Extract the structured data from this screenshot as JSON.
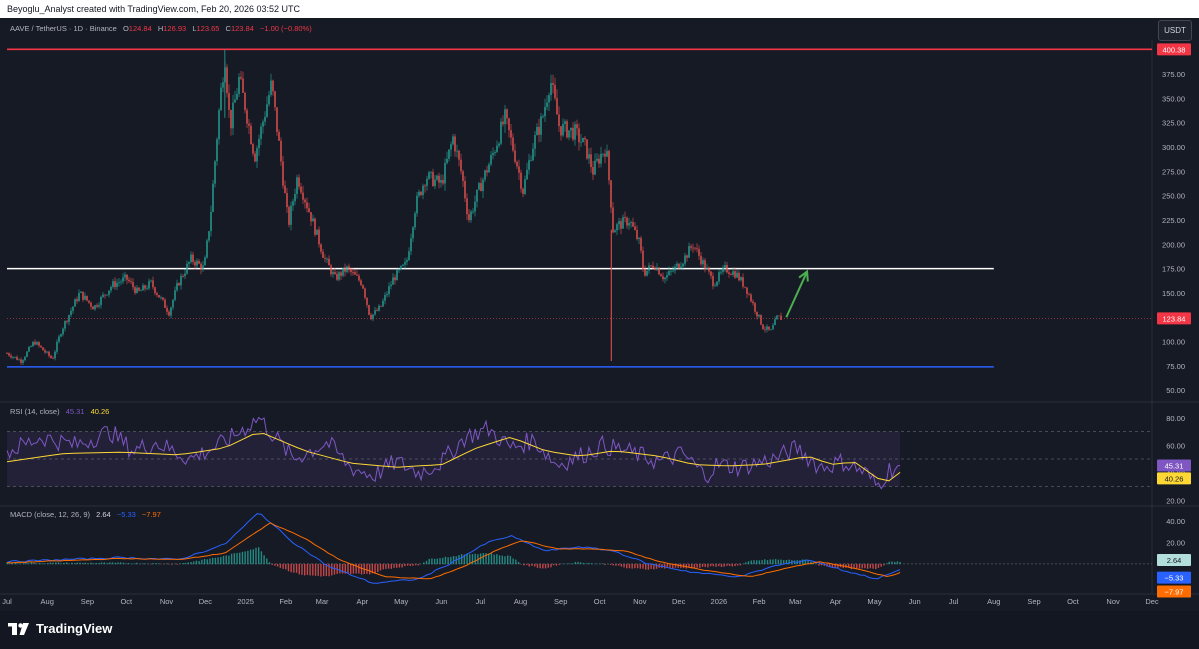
{
  "header": {
    "credit": "Beyoglu_Analyst created with TradingView.com, Feb 20, 2026 03:52 UTC"
  },
  "legend": {
    "symbol": "AAVE / TetherUS · 1D · Binance",
    "o_label": "O",
    "o_value": "124.84",
    "h_label": "H",
    "h_value": "126.93",
    "l_label": "L",
    "l_value": "123.65",
    "c_label": "C",
    "c_value": "123.84",
    "change": "−1.00 (−0.80%)"
  },
  "currency_button": "USDT",
  "rsi_legend": {
    "title": "RSI (14, close)",
    "rsi": "45.31",
    "ma": "40.26"
  },
  "macd_legend": {
    "title": "MACD (close, 12, 26, 9)",
    "hist": "2.64",
    "macd": "−5.33",
    "signal": "−7.97"
  },
  "footer": {
    "brand": "TradingView"
  },
  "colors": {
    "up": "#26a69a",
    "down": "#ef5350",
    "resistance": "#f23645",
    "support": "#2962ff",
    "level": "#ffffff",
    "arrow": "#4caf50",
    "rsi": "#7e57c2",
    "rsi_ma": "#fdd835",
    "macd": "#2962ff",
    "signal": "#ff6d00"
  },
  "chart_data": [
    {
      "type": "candlestick",
      "title": "AAVE / TetherUS · 1D · Binance",
      "x_ticks": [
        "Jul",
        "Aug",
        "Sep",
        "Oct",
        "Nov",
        "Dec",
        "2025",
        "Feb",
        "Mar",
        "Apr",
        "May",
        "Jun",
        "Jul",
        "Aug",
        "Sep",
        "Oct",
        "Nov",
        "Dec",
        "2026",
        "Feb",
        "Mar",
        "Apr",
        "May",
        "Jun",
        "Jul",
        "Aug",
        "Sep",
        "Oct",
        "Nov",
        "Dec"
      ],
      "y_ticks": [
        50,
        75,
        100,
        125,
        150,
        175,
        200,
        225,
        250,
        275,
        300,
        325,
        350,
        375
      ],
      "ylim": [
        42,
        410
      ],
      "price_path": [
        [
          "2024-07-01",
          88
        ],
        [
          "2024-07-12",
          80
        ],
        [
          "2024-07-22",
          100
        ],
        [
          "2024-08-05",
          82
        ],
        [
          "2024-08-12",
          112
        ],
        [
          "2024-08-26",
          150
        ],
        [
          "2024-09-06",
          135
        ],
        [
          "2024-09-20",
          158
        ],
        [
          "2024-10-01",
          165
        ],
        [
          "2024-10-10",
          150
        ],
        [
          "2024-10-20",
          160
        ],
        [
          "2024-11-03",
          130
        ],
        [
          "2024-11-10",
          160
        ],
        [
          "2024-11-20",
          185
        ],
        [
          "2024-11-30",
          175
        ],
        [
          "2024-12-05",
          230
        ],
        [
          "2024-12-12",
          345
        ],
        [
          "2024-12-16",
          395
        ],
        [
          "2024-12-20",
          320
        ],
        [
          "2024-12-27",
          370
        ],
        [
          "2025-01-01",
          340
        ],
        [
          "2025-01-08",
          290
        ],
        [
          "2025-01-15",
          330
        ],
        [
          "2025-01-21",
          365
        ],
        [
          "2025-01-27",
          300
        ],
        [
          "2025-02-03",
          220
        ],
        [
          "2025-02-10",
          270
        ],
        [
          "2025-02-20",
          230
        ],
        [
          "2025-03-03",
          185
        ],
        [
          "2025-03-11",
          165
        ],
        [
          "2025-03-20",
          175
        ],
        [
          "2025-04-01",
          160
        ],
        [
          "2025-04-07",
          125
        ],
        [
          "2025-04-15",
          135
        ],
        [
          "2025-04-25",
          165
        ],
        [
          "2025-05-05",
          180
        ],
        [
          "2025-05-12",
          240
        ],
        [
          "2025-05-20",
          270
        ],
        [
          "2025-06-01",
          262
        ],
        [
          "2025-06-10",
          310
        ],
        [
          "2025-06-17",
          270
        ],
        [
          "2025-06-22",
          225
        ],
        [
          "2025-07-01",
          260
        ],
        [
          "2025-07-10",
          290
        ],
        [
          "2025-07-20",
          330
        ],
        [
          "2025-07-28",
          290
        ],
        [
          "2025-08-03",
          255
        ],
        [
          "2025-08-10",
          300
        ],
        [
          "2025-08-18",
          330
        ],
        [
          "2025-08-24",
          370
        ],
        [
          "2025-08-31",
          320
        ],
        [
          "2025-09-12",
          315
        ],
        [
          "2025-09-20",
          300
        ],
        [
          "2025-09-26",
          275
        ],
        [
          "2025-10-01",
          290
        ],
        [
          "2025-10-06",
          300
        ],
        [
          "2025-10-10",
          240
        ],
        [
          "2025-10-11",
          215
        ],
        [
          "2025-10-16",
          220
        ],
        [
          "2025-10-24",
          225
        ],
        [
          "2025-11-01",
          200
        ],
        [
          "2025-11-04",
          170
        ],
        [
          "2025-11-12",
          180
        ],
        [
          "2025-11-20",
          165
        ],
        [
          "2025-11-28",
          175
        ],
        [
          "2025-12-05",
          185
        ],
        [
          "2025-12-12",
          200
        ],
        [
          "2025-12-20",
          180
        ],
        [
          "2025-12-28",
          160
        ],
        [
          "2026-01-06",
          175
        ],
        [
          "2026-01-14",
          170
        ],
        [
          "2026-01-22",
          155
        ],
        [
          "2026-01-30",
          130
        ],
        [
          "2026-02-04",
          115
        ],
        [
          "2026-02-10",
          110
        ],
        [
          "2026-02-15",
          125
        ],
        [
          "2026-02-19",
          123.84
        ]
      ],
      "extremes": {
        "low_wick": {
          "date": "2025-10-10",
          "value": 80
        },
        "peak": {
          "date": "2024-12-16",
          "value": 400
        }
      },
      "horizontal_lines": [
        {
          "value": 400.38,
          "label": "400.38",
          "color": "#f23645",
          "end": "right-edge"
        },
        {
          "value": 175,
          "label": "",
          "color": "#ffffff",
          "end": "2026-08-01"
        },
        {
          "value": 74,
          "label": "",
          "color": "#2962ff",
          "end": "2026-08-01"
        }
      ],
      "last_price": {
        "value": 123.84,
        "label": "123.84"
      },
      "arrow": {
        "from": [
          "2026-02-22",
          125
        ],
        "to": [
          "2026-03-10",
          172
        ],
        "color": "#4caf50"
      }
    },
    {
      "type": "line",
      "title": "RSI (14, close)",
      "y_ticks": [
        20,
        40,
        60,
        80
      ],
      "ylim": [
        18,
        90
      ],
      "band": [
        30,
        70
      ],
      "series": [
        {
          "name": "RSI",
          "values": [
            [
              0,
              55
            ],
            [
              0.03,
              66
            ],
            [
              0.06,
              60
            ],
            [
              0.09,
              70
            ],
            [
              0.11,
              56
            ],
            [
              0.13,
              62
            ],
            [
              0.16,
              50
            ],
            [
              0.19,
              62
            ],
            [
              0.21,
              74
            ],
            [
              0.22,
              80
            ],
            [
              0.25,
              50
            ],
            [
              0.28,
              62
            ],
            [
              0.3,
              44
            ],
            [
              0.32,
              38
            ],
            [
              0.34,
              48
            ],
            [
              0.36,
              40
            ],
            [
              0.38,
              48
            ],
            [
              0.4,
              66
            ],
            [
              0.42,
              72
            ],
            [
              0.44,
              58
            ],
            [
              0.46,
              64
            ],
            [
              0.48,
              46
            ],
            [
              0.5,
              52
            ],
            [
              0.52,
              60
            ],
            [
              0.54,
              56
            ],
            [
              0.57,
              48
            ],
            [
              0.59,
              54
            ],
            [
              0.61,
              38
            ],
            [
              0.62,
              46
            ],
            [
              0.64,
              44
            ],
            [
              0.67,
              50
            ],
            [
              0.69,
              58
            ],
            [
              0.71,
              44
            ],
            [
              0.73,
              48
            ],
            [
              0.75,
              40
            ],
            [
              0.76,
              30
            ],
            [
              0.77,
              42
            ],
            [
              0.78,
              45.31
            ]
          ]
        },
        {
          "name": "RSI-based MA",
          "values": [
            [
              0,
              48
            ],
            [
              0.05,
              54
            ],
            [
              0.1,
              55
            ],
            [
              0.15,
              53
            ],
            [
              0.19,
              58
            ],
            [
              0.22,
              70
            ],
            [
              0.26,
              56
            ],
            [
              0.3,
              47
            ],
            [
              0.34,
              44
            ],
            [
              0.38,
              46
            ],
            [
              0.41,
              58
            ],
            [
              0.44,
              66
            ],
            [
              0.47,
              56
            ],
            [
              0.5,
              52
            ],
            [
              0.53,
              56
            ],
            [
              0.57,
              52
            ],
            [
              0.6,
              46
            ],
            [
              0.63,
              45
            ],
            [
              0.66,
              46
            ],
            [
              0.7,
              52
            ],
            [
              0.72,
              46
            ],
            [
              0.74,
              48
            ],
            [
              0.76,
              36
            ],
            [
              0.77,
              34
            ],
            [
              0.78,
              40.26
            ]
          ]
        }
      ],
      "last_values": [
        "45.31",
        "40.26"
      ]
    },
    {
      "type": "bar+line",
      "title": "MACD (close, 12, 26, 9)",
      "y_ticks": [
        -20,
        0,
        20,
        40
      ],
      "ylim": [
        -28,
        52
      ],
      "series": [
        {
          "name": "MACD",
          "values": [
            [
              0,
              2
            ],
            [
              0.05,
              4
            ],
            [
              0.1,
              6
            ],
            [
              0.15,
              4
            ],
            [
              0.19,
              18
            ],
            [
              0.22,
              48
            ],
            [
              0.25,
              20
            ],
            [
              0.28,
              -2
            ],
            [
              0.32,
              -18
            ],
            [
              0.36,
              -14
            ],
            [
              0.39,
              2
            ],
            [
              0.42,
              20
            ],
            [
              0.44,
              26
            ],
            [
              0.47,
              12
            ],
            [
              0.5,
              16
            ],
            [
              0.53,
              12
            ],
            [
              0.56,
              0
            ],
            [
              0.6,
              -8
            ],
            [
              0.64,
              -12
            ],
            [
              0.67,
              -2
            ],
            [
              0.7,
              4
            ],
            [
              0.73,
              -6
            ],
            [
              0.76,
              -14
            ],
            [
              0.78,
              -5.33
            ]
          ]
        },
        {
          "name": "Signal",
          "values": [
            [
              0,
              1
            ],
            [
              0.05,
              3
            ],
            [
              0.1,
              5
            ],
            [
              0.15,
              4
            ],
            [
              0.19,
              10
            ],
            [
              0.23,
              38
            ],
            [
              0.26,
              24
            ],
            [
              0.29,
              4
            ],
            [
              0.33,
              -12
            ],
            [
              0.37,
              -14
            ],
            [
              0.4,
              -2
            ],
            [
              0.43,
              14
            ],
            [
              0.45,
              22
            ],
            [
              0.48,
              14
            ],
            [
              0.51,
              14
            ],
            [
              0.54,
              12
            ],
            [
              0.57,
              2
            ],
            [
              0.61,
              -6
            ],
            [
              0.65,
              -12
            ],
            [
              0.68,
              -4
            ],
            [
              0.71,
              2
            ],
            [
              0.74,
              -4
            ],
            [
              0.77,
              -12
            ],
            [
              0.78,
              -7.97
            ]
          ]
        }
      ],
      "last_values": [
        "2.64",
        "−5.33",
        "−7.97"
      ]
    }
  ]
}
